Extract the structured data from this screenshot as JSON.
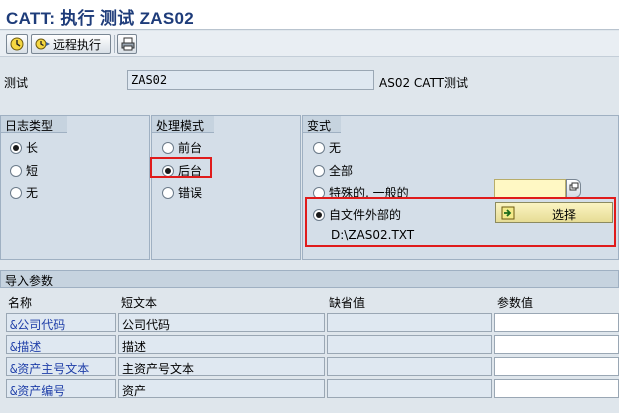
{
  "title": "CATT: 执行 测试 ZAS02",
  "toolbar": {
    "execute_icon": "execute-icon",
    "remote_label": "远程执行",
    "remote_icon": "remote-execute-icon",
    "print_icon": "print-icon"
  },
  "test_field": {
    "label": "测试",
    "value": "ZAS02",
    "description": "AS02 CATT测试"
  },
  "log_type": {
    "header": "日志类型",
    "options": [
      "长",
      "短",
      "无"
    ],
    "selected": "长"
  },
  "proc_mode": {
    "header": "处理模式",
    "options": [
      "前台",
      "后台",
      "错误"
    ],
    "selected": "后台"
  },
  "variant": {
    "header": "变式",
    "options": [
      "无",
      "全部",
      "特殊的, 一般的",
      "自文件外部的"
    ],
    "selected": "自文件外部的",
    "select_button_label": "选择",
    "file_path": "D:\\ZAS02.TXT"
  },
  "import_params": {
    "header": "导入参数",
    "columns": [
      "名称",
      "短文本",
      "缺省值",
      "参数值"
    ],
    "rows": [
      {
        "name": "&公司代码",
        "text": "公司代码",
        "default": "",
        "value": ""
      },
      {
        "name": "&描述",
        "text": "描述",
        "default": "",
        "value": ""
      },
      {
        "name": "&资产主号文本",
        "text": "主资产号文本",
        "default": "",
        "value": ""
      },
      {
        "name": "&资产编号",
        "text": "资产",
        "default": "",
        "value": ""
      }
    ]
  },
  "colors": {
    "title": "#1e3c7a",
    "highlight": "#e01b1b",
    "param_name": "#1f3ea8"
  }
}
